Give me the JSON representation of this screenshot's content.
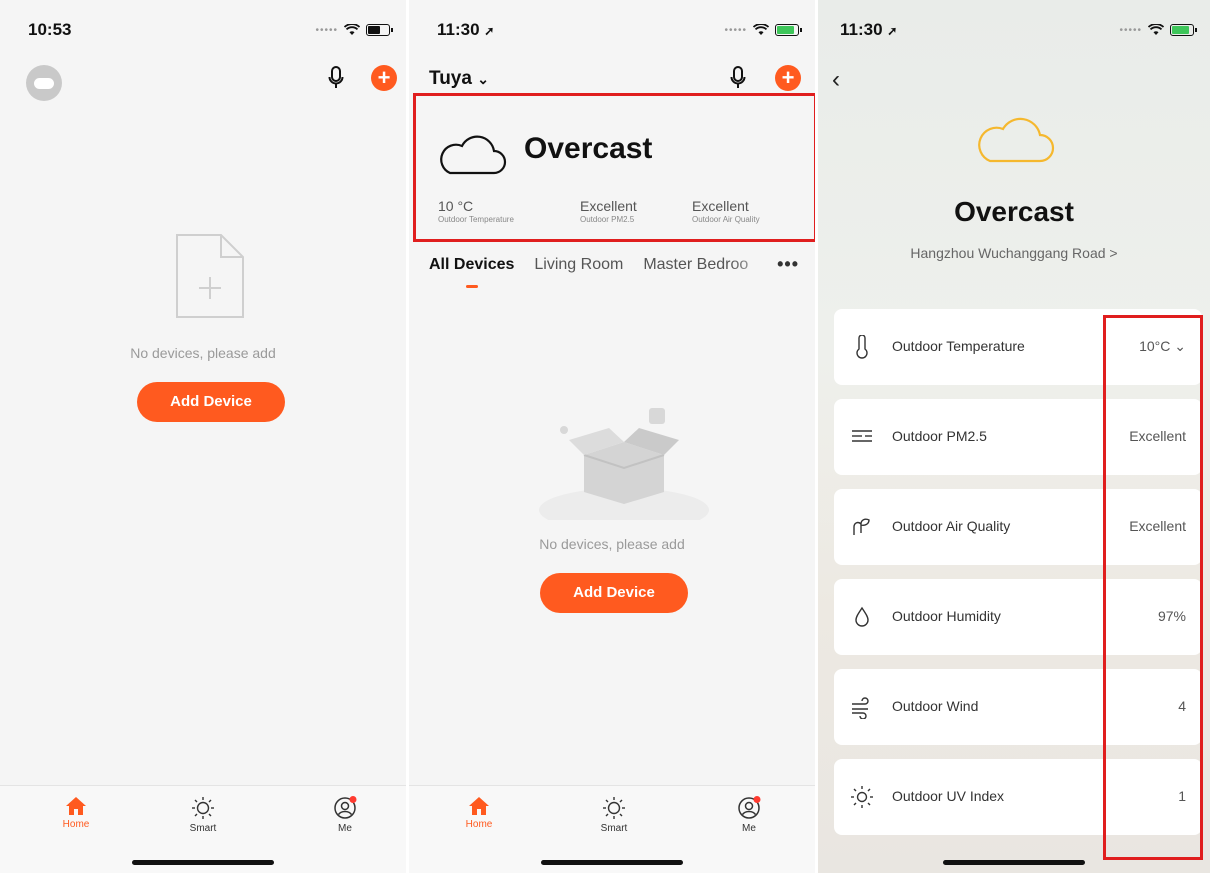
{
  "phone1": {
    "time": "10:53",
    "empty_text": "No devices, please add",
    "add_button": "Add Device",
    "tabs": [
      {
        "label": "Home",
        "icon": "home-icon",
        "active": true
      },
      {
        "label": "Smart",
        "icon": "sun-icon",
        "active": false
      },
      {
        "label": "Me",
        "icon": "profile-icon",
        "active": false
      }
    ]
  },
  "phone2": {
    "time": "11:30",
    "home_name": "Tuya",
    "weather": {
      "condition": "Overcast",
      "stats": [
        {
          "value": "10 °C",
          "label": "Outdoor Temperature"
        },
        {
          "value": "Excellent",
          "label": "Outdoor PM2.5"
        },
        {
          "value": "Excellent",
          "label": "Outdoor Air Quality"
        }
      ]
    },
    "rooms": [
      "All Devices",
      "Living Room",
      "Master Bedroo"
    ],
    "more": "•••",
    "empty_text": "No devices, please add",
    "add_button": "Add Device",
    "tabs": [
      {
        "label": "Home"
      },
      {
        "label": "Smart"
      },
      {
        "label": "Me"
      }
    ]
  },
  "phone3": {
    "time": "11:30",
    "condition": "Overcast",
    "location": "Hangzhou Wuchanggang Road >",
    "rows": [
      {
        "label": "Outdoor Temperature",
        "value": "10°C ⌄",
        "icon": "thermometer-icon"
      },
      {
        "label": "Outdoor PM2.5",
        "value": "Excellent",
        "icon": "pm25-icon"
      },
      {
        "label": "Outdoor Air Quality",
        "value": "Excellent",
        "icon": "leaf-icon"
      },
      {
        "label": "Outdoor Humidity",
        "value": "97%",
        "icon": "droplet-icon"
      },
      {
        "label": "Outdoor Wind",
        "value": "4",
        "icon": "wind-icon"
      },
      {
        "label": "Outdoor UV Index",
        "value": "1",
        "icon": "sun-icon"
      }
    ]
  },
  "colors": {
    "accent": "#ff5a1f",
    "highlight_border": "#e01e1e",
    "cloud_yellow": "#f5b82e"
  }
}
